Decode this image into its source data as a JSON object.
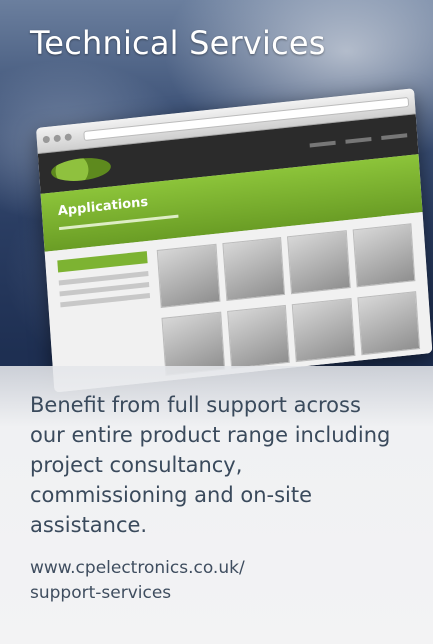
{
  "header": {
    "title": "Technical Services"
  },
  "screenshot": {
    "banner_title": "Applications"
  },
  "panel": {
    "description": "Benefit from full support across our entire product range including project consultancy, commissioning and on-site assistance.",
    "url_line1": "www.cpelectronics.co.uk/",
    "url_line2": "support-services"
  },
  "colors": {
    "accent_green": "#7db332",
    "text": "#3a4a5c"
  }
}
